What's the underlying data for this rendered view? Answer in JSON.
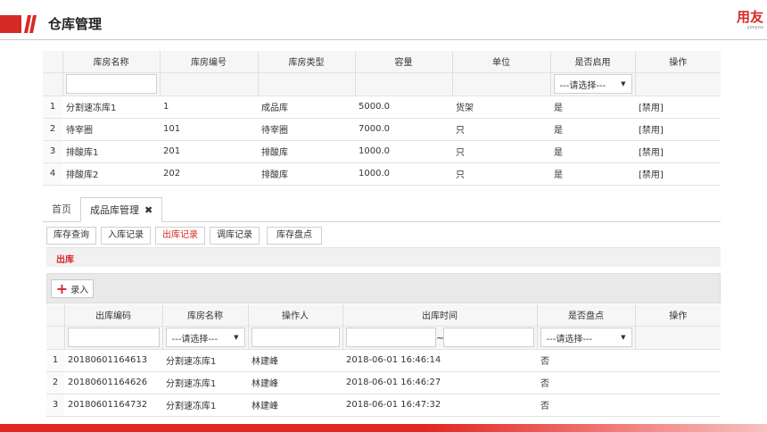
{
  "header": {
    "title": "仓库管理",
    "logo_main": "用友",
    "logo_sub": "yonyou",
    "brand_color": "#d62a26"
  },
  "warehouse_table": {
    "columns": [
      "库房名称",
      "库房编号",
      "库房类型",
      "容量",
      "单位",
      "是否启用",
      "操作"
    ],
    "enabled_filter": "---请选择---",
    "rows": [
      {
        "num": "1",
        "name": "分割速冻库1",
        "code": "1",
        "type": "成品库",
        "capacity": "5000.0",
        "unit": "货架",
        "enabled": "是",
        "action": "[禁用]"
      },
      {
        "num": "2",
        "name": "待宰圈",
        "code": "101",
        "type": "待宰圈",
        "capacity": "7000.0",
        "unit": "只",
        "enabled": "是",
        "action": "[禁用]"
      },
      {
        "num": "3",
        "name": "排酸库1",
        "code": "201",
        "type": "排酸库",
        "capacity": "1000.0",
        "unit": "只",
        "enabled": "是",
        "action": "[禁用]"
      },
      {
        "num": "4",
        "name": "排酸库2",
        "code": "202",
        "type": "排酸库",
        "capacity": "1000.0",
        "unit": "只",
        "enabled": "是",
        "action": "[禁用]"
      }
    ]
  },
  "tabs": {
    "home": "首页",
    "active": "成品库管理",
    "close": "✖"
  },
  "subtabs": [
    "库存查询",
    "入库记录",
    "出库记录",
    "调库记录",
    "库存盘点"
  ],
  "panel": {
    "title": "出库",
    "add_button": "录入",
    "add_icon": "+"
  },
  "outbound_table": {
    "columns": [
      "出库编码",
      "库房名称",
      "操作人",
      "出库时间",
      "是否盘点",
      "操作"
    ],
    "warehouse_filter": "---请选择---",
    "inventory_filter": "---请选择---",
    "range_separator": "~",
    "rows": [
      {
        "num": "1",
        "code": "20180601164613",
        "warehouse": "分割速冻库1",
        "operator": "林建峰",
        "time": "2018-06-01 16:46:14",
        "inventory": "否"
      },
      {
        "num": "2",
        "code": "20180601164626",
        "warehouse": "分割速冻库1",
        "operator": "林建峰",
        "time": "2018-06-01 16:46:27",
        "inventory": "否"
      },
      {
        "num": "3",
        "code": "20180601164732",
        "warehouse": "分割速冻库1",
        "operator": "林建峰",
        "time": "2018-06-01 16:47:32",
        "inventory": "否"
      }
    ]
  }
}
